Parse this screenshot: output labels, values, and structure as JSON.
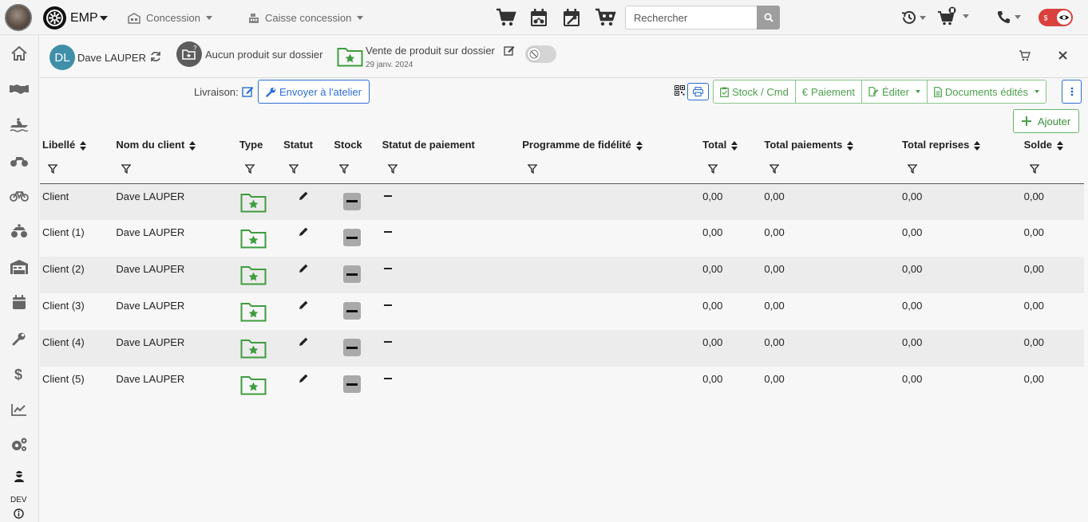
{
  "topbar": {
    "brand": "EMP",
    "nav": [
      {
        "label": "Concession",
        "icon": "building-icon"
      },
      {
        "label": "Caisse concession",
        "icon": "cash-register-icon"
      }
    ],
    "quick_icons": [
      "cart-icon",
      "calendar-moto-icon",
      "calendar-wrench-icon",
      "cart-moto-icon"
    ],
    "search": {
      "placeholder": "Rechercher",
      "value": ""
    },
    "right_icons": [
      "history-icon",
      "cart-badge-icon",
      "phone-icon"
    ],
    "accent_color": "#d9413c"
  },
  "sidebar": {
    "items": [
      "home-icon",
      "handshake-icon",
      "jetski-icon",
      "motorcycle-icon",
      "bicycle-icon",
      "atv-icon",
      "store-icon",
      "calendar-icon",
      "wrench-icon",
      "dollar-icon",
      "chart-line-icon",
      "cogs-icon",
      "user-icon"
    ],
    "env_label": "DEV"
  },
  "context": {
    "client_initials": "DL",
    "client_name": "Dave LAUPER",
    "no_product": "Aucun produit sur dossier",
    "sale_title": "Vente de produit sur dossier",
    "sale_date": "29 janv. 2024"
  },
  "actions": {
    "delivery_label": "Livraison:",
    "send_workshop": "Envoyer à l'atelier",
    "stock_cmd": "Stock / Cmd",
    "payment": "Paiement",
    "edit": "Éditer",
    "documents": "Documents édités",
    "add": "Ajouter"
  },
  "table": {
    "columns": [
      "Libellé",
      "Nom du client",
      "Type",
      "Statut",
      "Stock",
      "Statut de paiement",
      "Programme de fidélité",
      "Total",
      "Total paiements",
      "Total reprises",
      "Solde"
    ],
    "rows": [
      {
        "label": "Client",
        "client": "Dave LAUPER",
        "total": "0,00",
        "total_payments": "0,00",
        "total_trades": "0,00",
        "balance": "0,00"
      },
      {
        "label": "Client (1)",
        "client": "Dave LAUPER",
        "total": "0,00",
        "total_payments": "0,00",
        "total_trades": "0,00",
        "balance": "0,00"
      },
      {
        "label": "Client (2)",
        "client": "Dave LAUPER",
        "total": "0,00",
        "total_payments": "0,00",
        "total_trades": "0,00",
        "balance": "0,00"
      },
      {
        "label": "Client (3)",
        "client": "Dave LAUPER",
        "total": "0,00",
        "total_payments": "0,00",
        "total_trades": "0,00",
        "balance": "0,00"
      },
      {
        "label": "Client (4)",
        "client": "Dave LAUPER",
        "total": "0,00",
        "total_payments": "0,00",
        "total_trades": "0,00",
        "balance": "0,00"
      },
      {
        "label": "Client (5)",
        "client": "Dave LAUPER",
        "total": "0,00",
        "total_payments": "0,00",
        "total_trades": "0,00",
        "balance": "0,00"
      }
    ]
  }
}
